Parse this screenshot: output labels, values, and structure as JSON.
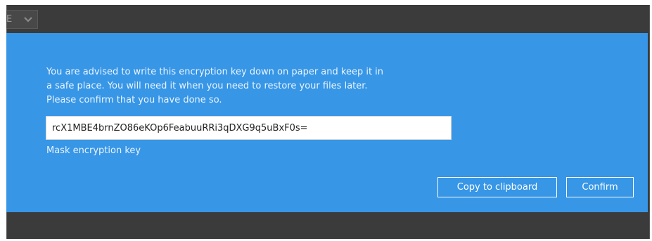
{
  "background_select": {
    "visible_text": "E",
    "icon": "chevron-down-icon"
  },
  "dialog": {
    "message_lines": [
      "You are advised to write this encryption key down on paper and keep it in",
      "a safe place. You will need it when you need to restore your files later.",
      "Please confirm that you have done so."
    ],
    "encryption_key": "rcX1MBE4brnZO86eKOp6FeabuuRRi3qDXG9q5uBxF0s=",
    "mask_link_label": "Mask encryption key",
    "copy_button_label": "Copy to clipboard",
    "confirm_button_label": "Confirm"
  },
  "colors": {
    "dialog_background": "#3796e6",
    "window_background": "#3b3b3b",
    "button_border": "#ffffff"
  }
}
